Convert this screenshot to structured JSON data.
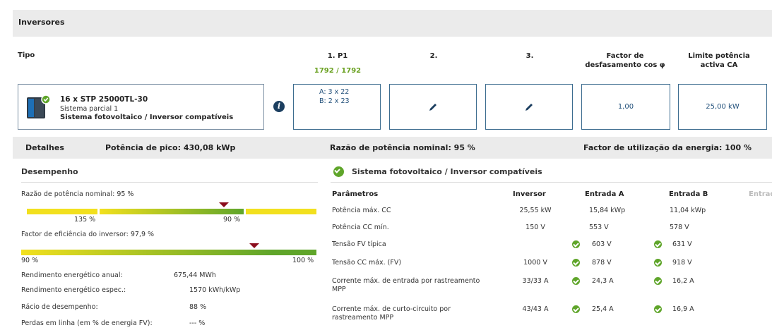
{
  "section_title": "Inversores",
  "table_head": {
    "tipo": "Tipo",
    "col1": "1. P1",
    "col1_value": "1792 / 1792",
    "col2": "2.",
    "col3": "3.",
    "col4_line1": "Factor de",
    "col4_line2": "desfasamento cos φ",
    "col5_line1": "Limite potência",
    "col5_line2": "activa CA"
  },
  "inverter": {
    "name": "16 x STP 25000TL-30",
    "subtitle": "Sistema parcial 1",
    "status": "Sistema fotovoltaico / Inversor compatíveis",
    "input_a": "A: 3 x 22",
    "input_b": "B: 2 x 23",
    "cos_phi": "1,00",
    "power_limit": "25,00 kW"
  },
  "details": {
    "label": "Detalhes",
    "peak_power": "Potência de pico: 430,08 kWp",
    "nominal_ratio": "Razão de potência nominal: 95 %",
    "energy_usage": "Factor de utilização da energia: 100 %"
  },
  "performance": {
    "title": "Desempenho",
    "ratio_label": "Razão de potência nominal: 95 %",
    "ratio_bar": {
      "left_label": "135 %",
      "right_label": "90 %",
      "marker_fraction": 0.68
    },
    "eff_label": "Factor de eficiência do inversor: 97,9 %",
    "eff_bar": {
      "left_label": "90 %",
      "right_label": "100 %",
      "marker_fraction": 0.79
    },
    "rows": [
      {
        "label": "Rendimento energético anual:",
        "value": "675,44 MWh"
      },
      {
        "label": "Rendimento energético espec.:",
        "value": "1570 kWh/kWp"
      },
      {
        "label": "Rácio de desempenho:",
        "value": "88 %"
      },
      {
        "label": "Perdas em linha (em % de energia FV):",
        "value": "--- %"
      }
    ]
  },
  "compat": {
    "title": "Sistema fotovoltaico / Inversor compatíveis",
    "headers": [
      "Parâmetros",
      "Inversor",
      "Entrada A",
      "Entrada B",
      "Entrad"
    ],
    "rows": [
      {
        "param": "Potência máx. CC",
        "param2": "",
        "inv": "25,55 kW",
        "a": "15,84 kWp",
        "a_ok": false,
        "b": "11,04 kWp",
        "b_ok": false
      },
      {
        "param": "Potência CC mín.",
        "param2": "",
        "inv": "150 V",
        "a": "553 V",
        "a_ok": false,
        "b": "578 V",
        "b_ok": false
      },
      {
        "param": "Tensão FV típica",
        "param2": "",
        "inv": "",
        "a": "603 V",
        "a_ok": true,
        "b": "631 V",
        "b_ok": true
      },
      {
        "param": "Tensão CC máx. (FV)",
        "param2": "",
        "inv": "1000 V",
        "a": "878 V",
        "a_ok": true,
        "b": "918 V",
        "b_ok": true
      },
      {
        "param": "Corrente máx. de entrada por rastreamento",
        "param2": "MPP",
        "inv": "33/33 A",
        "a": "24,3 A",
        "a_ok": true,
        "b": "16,2 A",
        "b_ok": true
      },
      {
        "param": "Corrente máx. de curto-circuito por",
        "param2": "rastreamento MPP",
        "inv": "43/43 A",
        "a": "25,4 A",
        "a_ok": true,
        "b": "16,9 A",
        "b_ok": true
      }
    ]
  },
  "colors": {
    "accent_green": "#6aa121",
    "border_blue": "#3c6c8f",
    "marker": "#8b0c1c"
  }
}
